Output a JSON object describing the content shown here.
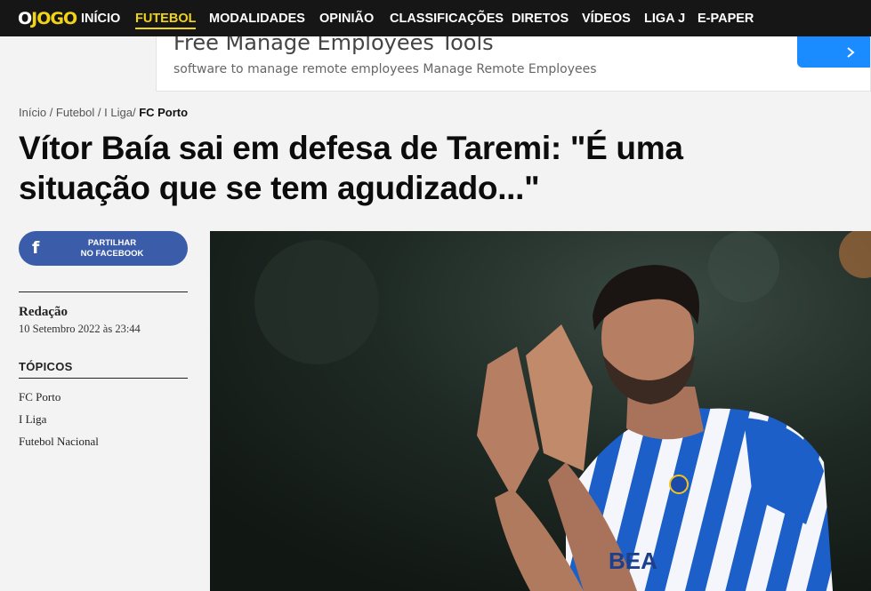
{
  "logo": {
    "o": "O",
    "jogo": "JOGO"
  },
  "nav": {
    "items": [
      {
        "label": "INÍCIO",
        "active": false
      },
      {
        "label": "FUTEBOL",
        "active": true
      },
      {
        "label": "MODALIDADES",
        "active": false
      },
      {
        "label": "OPINIÃO",
        "active": false
      },
      {
        "label": "CLASSIFICAÇÕES",
        "active": false
      },
      {
        "label": "DIRETOS",
        "active": false
      },
      {
        "label": "VÍDEOS",
        "active": false
      },
      {
        "label": "LIGA J",
        "active": false
      },
      {
        "label": "E-PAPER",
        "active": false
      }
    ]
  },
  "ad": {
    "title": "Free Manage Employees Tools",
    "subtitle": "software to manage remote employees Manage Remote Employees",
    "button_icon": "chevron-right-icon"
  },
  "breadcrumb": {
    "items": [
      "Início",
      "Futebol",
      "I Liga",
      "FC Porto"
    ]
  },
  "article": {
    "headline": "Vítor Baía sai em defesa de Taremi: \"É uma situação que se tem agudizado...\"",
    "share_line1": "PARTILHAR",
    "share_line2": "NO FACEBOOK",
    "share_icon": "facebook-icon",
    "author": "Redação",
    "date": "10 Setembro 2022 às 23:44",
    "topics_title": "TÓPICOS",
    "topics": [
      "FC Porto",
      "I Liga",
      "Futebol Nacional"
    ]
  },
  "photo": {
    "jersey_text": "BEA"
  },
  "colors": {
    "nav_bg": "#161616",
    "accent_yellow": "#f1d418",
    "facebook_blue": "#3b5ca8",
    "ad_button_blue": "#1a8cff",
    "page_bg": "#f3f3f3"
  }
}
